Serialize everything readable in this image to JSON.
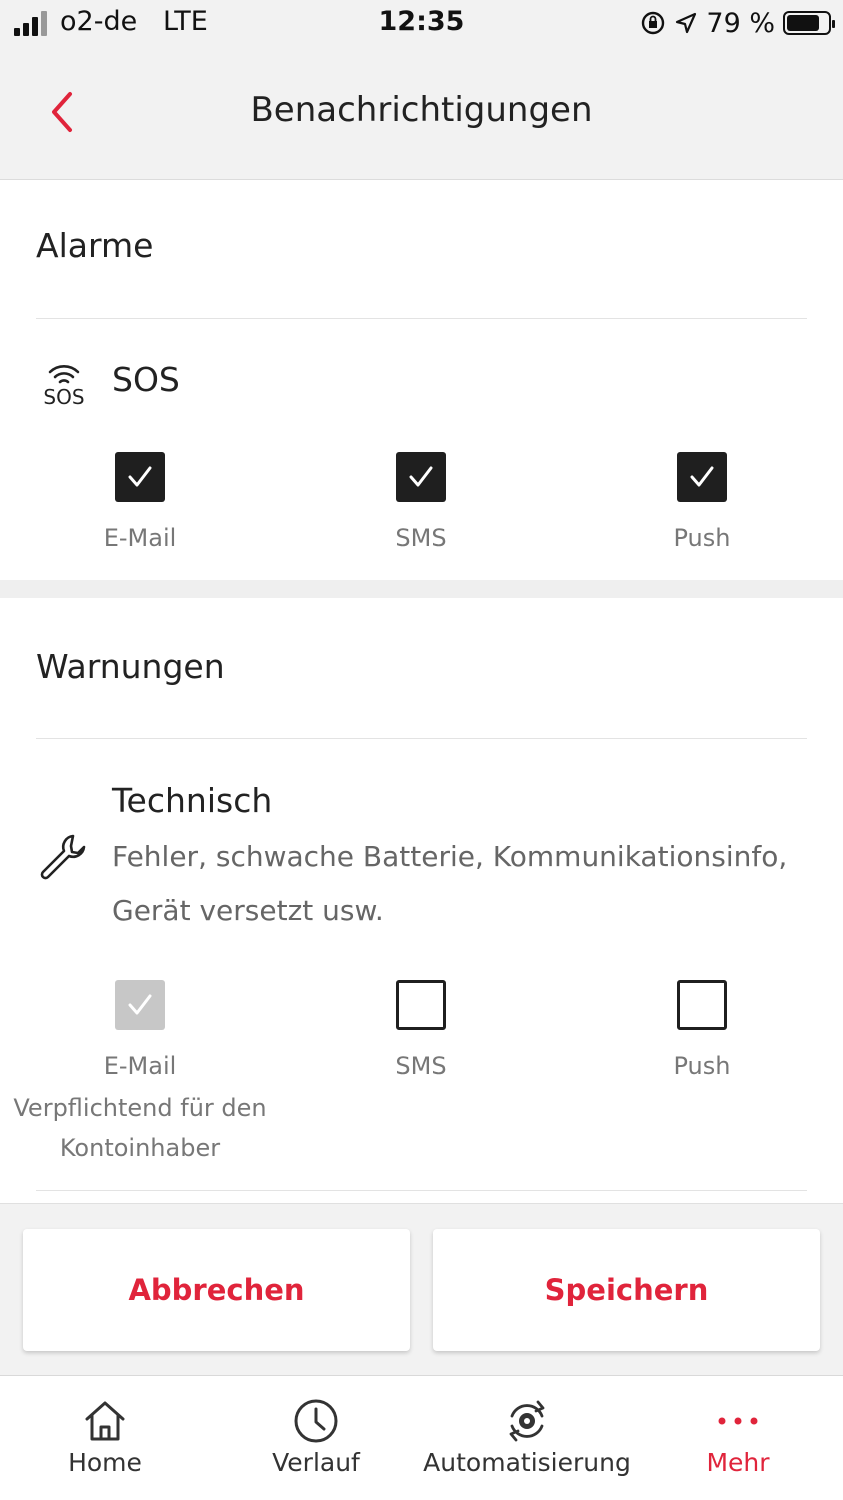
{
  "status_bar": {
    "carrier": "o2-de",
    "network": "LTE",
    "time": "12:35",
    "battery_text": "79 %",
    "battery_level": 0.79
  },
  "header": {
    "title": "Benachrichtigungen",
    "back_icon": "chevron-left-icon"
  },
  "alarme": {
    "title": "Alarme",
    "rows": [
      {
        "icon": "sos-icon",
        "icon_text": "SOS",
        "label": "SOS",
        "options": [
          {
            "label": "E-Mail",
            "state": "checked"
          },
          {
            "label": "SMS",
            "state": "checked"
          },
          {
            "label": "Push",
            "state": "checked"
          }
        ]
      }
    ]
  },
  "warnungen": {
    "title": "Warnungen",
    "rows": [
      {
        "icon": "wrench-icon",
        "label": "Technisch",
        "description": "Fehler, schwache Batterie, Kommunikationsinfo, Gerät versetzt usw.",
        "options": [
          {
            "label": "E-Mail",
            "state": "checked-disabled",
            "note": "Verpflichtend für den Kontoinhaber"
          },
          {
            "label": "SMS",
            "state": "unchecked"
          },
          {
            "label": "Push",
            "state": "unchecked"
          }
        ]
      }
    ]
  },
  "actions": {
    "cancel": "Abbrechen",
    "save": "Speichern"
  },
  "tabbar": {
    "items": [
      {
        "label": "Home",
        "icon": "home-icon",
        "active": false
      },
      {
        "label": "Verlauf",
        "icon": "clock-icon",
        "active": false
      },
      {
        "label": "Automatisierung",
        "icon": "automation-icon",
        "active": false
      },
      {
        "label": "Mehr",
        "icon": "more-dots-icon",
        "active": true
      }
    ]
  },
  "colors": {
    "accent": "#e0243b",
    "checkbox_checked": "#1f1f1f",
    "checkbox_disabled": "#c7c7c7",
    "header_bg": "#f2f2f2"
  }
}
